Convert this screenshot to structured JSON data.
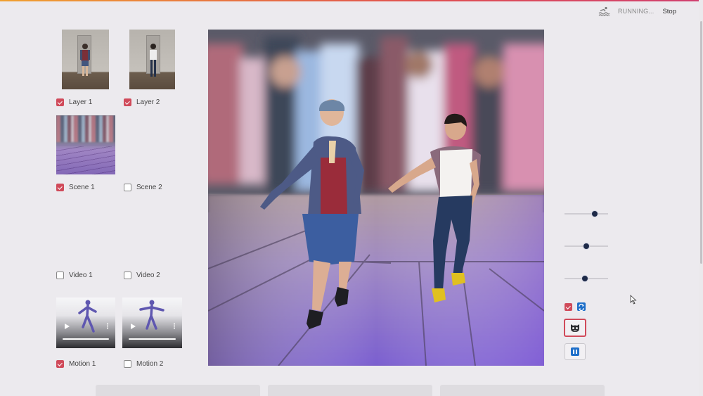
{
  "status": {
    "running_label": "RUNNING...",
    "stop_label": "Stop"
  },
  "layers": [
    {
      "label": "Layer 1",
      "checked": true
    },
    {
      "label": "Layer 2",
      "checked": true
    }
  ],
  "scenes": [
    {
      "label": "Scene 1",
      "checked": true
    },
    {
      "label": "Scene 2",
      "checked": false
    }
  ],
  "videos": [
    {
      "label": "Video 1",
      "checked": false
    },
    {
      "label": "Video 2",
      "checked": false
    }
  ],
  "motions": [
    {
      "label": "Motion 1",
      "checked": true
    },
    {
      "label": "Motion 2",
      "checked": false
    }
  ],
  "sliders": [
    0.7,
    0.5,
    0.47
  ],
  "accent": "#d04a5a",
  "icons": {
    "status": "swimmer-icon",
    "refresh": "refresh-icon",
    "mask": "mask-icon",
    "pause": "pause-icon"
  }
}
